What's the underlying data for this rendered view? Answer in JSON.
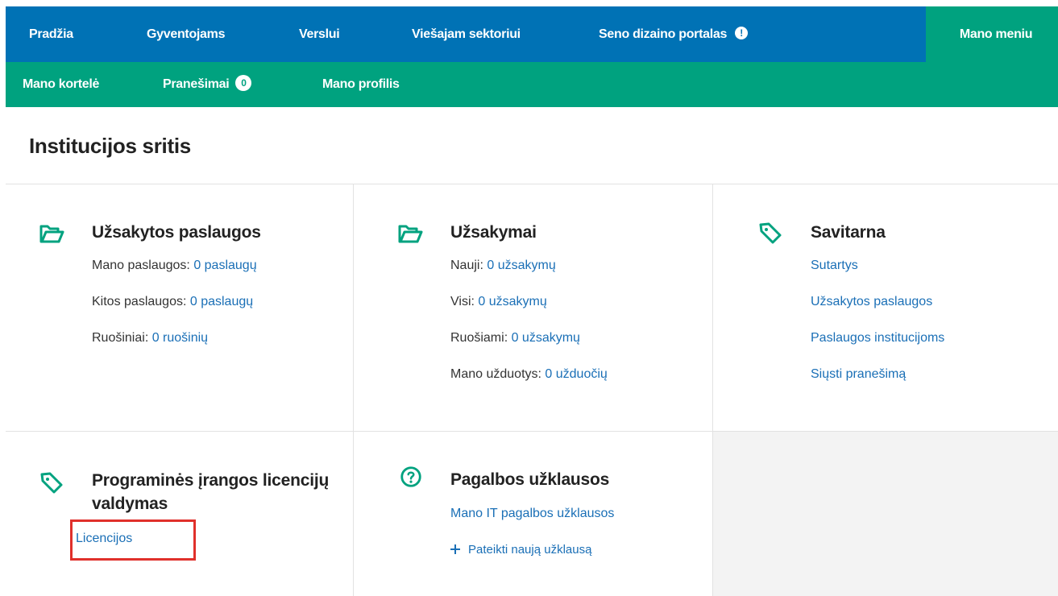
{
  "topnav": {
    "items": [
      "Pradžia",
      "Gyventojams",
      "Verslui",
      "Viešajam sektoriui",
      "Seno dizaino portalas"
    ],
    "alert_icon": "exclamation-circle-icon",
    "mano_meniu": "Mano meniu"
  },
  "subnav": {
    "items": [
      "Mano kortelė",
      "Pranešimai",
      "Mano profilis"
    ],
    "notification_count": "0"
  },
  "page_title": "Institucijos sritis",
  "cards": {
    "uzsakytos": {
      "title": "Užsakytos paslaugos",
      "icon": "folder-icon",
      "rows": [
        {
          "label": "Mano paslaugos: ",
          "link": "0 paslaugų"
        },
        {
          "label": "Kitos paslaugos: ",
          "link": "0 paslaugų"
        },
        {
          "label": "Ruošiniai: ",
          "link": "0 ruošinių"
        }
      ]
    },
    "uzsakymai": {
      "title": "Užsakymai",
      "icon": "folder-icon",
      "rows": [
        {
          "label": "Nauji: ",
          "link": "0 užsakymų"
        },
        {
          "label": "Visi: ",
          "link": "0 užsakymų"
        },
        {
          "label": "Ruošiami: ",
          "link": "0 užsakymų"
        },
        {
          "label": "Mano užduotys: ",
          "link": "0 užduočių"
        }
      ]
    },
    "savitarna": {
      "title": "Savitarna",
      "icon": "tag-icon",
      "links": [
        "Sutartys",
        "Užsakytos paslaugos",
        "Paslaugos institucijoms",
        "Siųsti pranešimą"
      ]
    },
    "licencijos": {
      "title_line1": "Programinės įrangos licencijų",
      "title_line2": "valdymas",
      "icon": "tag-icon",
      "link": "Licencijos"
    },
    "pagalba": {
      "title": "Pagalbos užklausos",
      "icon": "question-circle-icon",
      "link1": "Mano IT pagalbos užklausos",
      "link2": "Pateikti naują užklausą"
    }
  },
  "colors": {
    "primary_blue": "#0072b5",
    "green": "#00a27f",
    "link": "#1a6fb6",
    "highlight_red": "#e0302b"
  }
}
